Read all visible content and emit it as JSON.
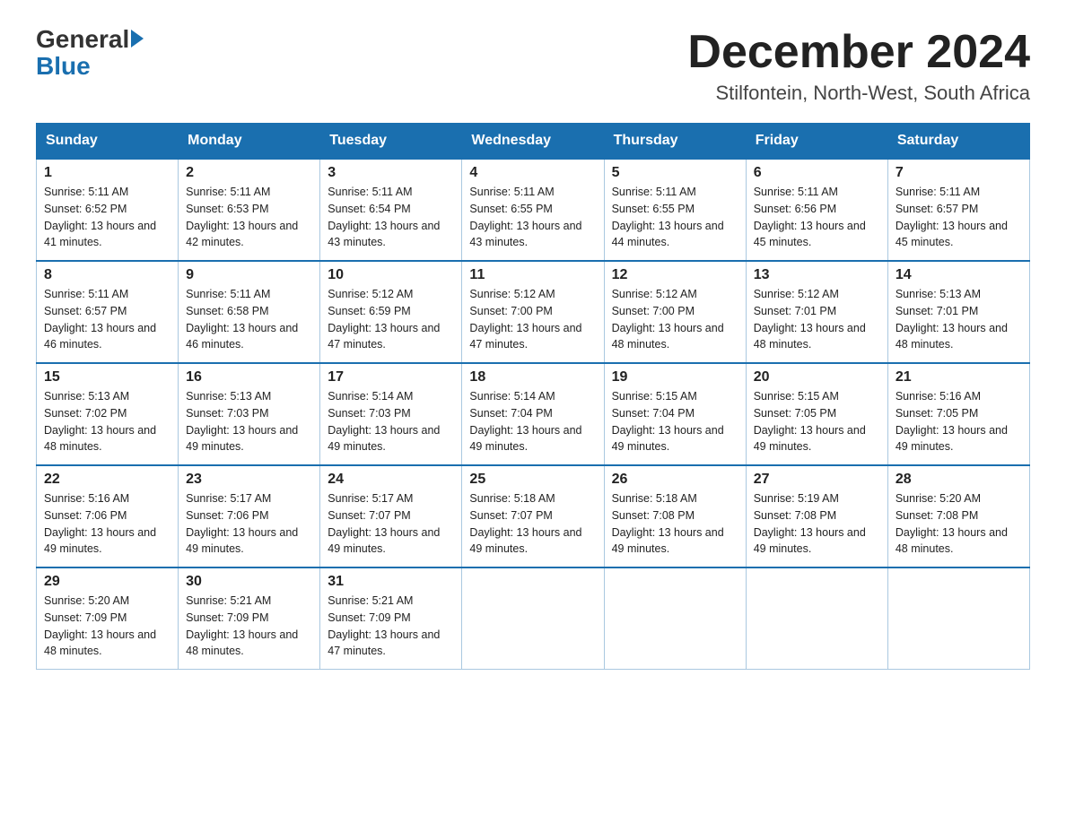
{
  "header": {
    "logo_general": "General",
    "logo_blue": "Blue",
    "month_title": "December 2024",
    "location": "Stilfontein, North-West, South Africa"
  },
  "weekdays": [
    "Sunday",
    "Monday",
    "Tuesday",
    "Wednesday",
    "Thursday",
    "Friday",
    "Saturday"
  ],
  "weeks": [
    [
      {
        "day": "1",
        "sunrise": "5:11 AM",
        "sunset": "6:52 PM",
        "daylight": "13 hours and 41 minutes."
      },
      {
        "day": "2",
        "sunrise": "5:11 AM",
        "sunset": "6:53 PM",
        "daylight": "13 hours and 42 minutes."
      },
      {
        "day": "3",
        "sunrise": "5:11 AM",
        "sunset": "6:54 PM",
        "daylight": "13 hours and 43 minutes."
      },
      {
        "day": "4",
        "sunrise": "5:11 AM",
        "sunset": "6:55 PM",
        "daylight": "13 hours and 43 minutes."
      },
      {
        "day": "5",
        "sunrise": "5:11 AM",
        "sunset": "6:55 PM",
        "daylight": "13 hours and 44 minutes."
      },
      {
        "day": "6",
        "sunrise": "5:11 AM",
        "sunset": "6:56 PM",
        "daylight": "13 hours and 45 minutes."
      },
      {
        "day": "7",
        "sunrise": "5:11 AM",
        "sunset": "6:57 PM",
        "daylight": "13 hours and 45 minutes."
      }
    ],
    [
      {
        "day": "8",
        "sunrise": "5:11 AM",
        "sunset": "6:57 PM",
        "daylight": "13 hours and 46 minutes."
      },
      {
        "day": "9",
        "sunrise": "5:11 AM",
        "sunset": "6:58 PM",
        "daylight": "13 hours and 46 minutes."
      },
      {
        "day": "10",
        "sunrise": "5:12 AM",
        "sunset": "6:59 PM",
        "daylight": "13 hours and 47 minutes."
      },
      {
        "day": "11",
        "sunrise": "5:12 AM",
        "sunset": "7:00 PM",
        "daylight": "13 hours and 47 minutes."
      },
      {
        "day": "12",
        "sunrise": "5:12 AM",
        "sunset": "7:00 PM",
        "daylight": "13 hours and 48 minutes."
      },
      {
        "day": "13",
        "sunrise": "5:12 AM",
        "sunset": "7:01 PM",
        "daylight": "13 hours and 48 minutes."
      },
      {
        "day": "14",
        "sunrise": "5:13 AM",
        "sunset": "7:01 PM",
        "daylight": "13 hours and 48 minutes."
      }
    ],
    [
      {
        "day": "15",
        "sunrise": "5:13 AM",
        "sunset": "7:02 PM",
        "daylight": "13 hours and 48 minutes."
      },
      {
        "day": "16",
        "sunrise": "5:13 AM",
        "sunset": "7:03 PM",
        "daylight": "13 hours and 49 minutes."
      },
      {
        "day": "17",
        "sunrise": "5:14 AM",
        "sunset": "7:03 PM",
        "daylight": "13 hours and 49 minutes."
      },
      {
        "day": "18",
        "sunrise": "5:14 AM",
        "sunset": "7:04 PM",
        "daylight": "13 hours and 49 minutes."
      },
      {
        "day": "19",
        "sunrise": "5:15 AM",
        "sunset": "7:04 PM",
        "daylight": "13 hours and 49 minutes."
      },
      {
        "day": "20",
        "sunrise": "5:15 AM",
        "sunset": "7:05 PM",
        "daylight": "13 hours and 49 minutes."
      },
      {
        "day": "21",
        "sunrise": "5:16 AM",
        "sunset": "7:05 PM",
        "daylight": "13 hours and 49 minutes."
      }
    ],
    [
      {
        "day": "22",
        "sunrise": "5:16 AM",
        "sunset": "7:06 PM",
        "daylight": "13 hours and 49 minutes."
      },
      {
        "day": "23",
        "sunrise": "5:17 AM",
        "sunset": "7:06 PM",
        "daylight": "13 hours and 49 minutes."
      },
      {
        "day": "24",
        "sunrise": "5:17 AM",
        "sunset": "7:07 PM",
        "daylight": "13 hours and 49 minutes."
      },
      {
        "day": "25",
        "sunrise": "5:18 AM",
        "sunset": "7:07 PM",
        "daylight": "13 hours and 49 minutes."
      },
      {
        "day": "26",
        "sunrise": "5:18 AM",
        "sunset": "7:08 PM",
        "daylight": "13 hours and 49 minutes."
      },
      {
        "day": "27",
        "sunrise": "5:19 AM",
        "sunset": "7:08 PM",
        "daylight": "13 hours and 49 minutes."
      },
      {
        "day": "28",
        "sunrise": "5:20 AM",
        "sunset": "7:08 PM",
        "daylight": "13 hours and 48 minutes."
      }
    ],
    [
      {
        "day": "29",
        "sunrise": "5:20 AM",
        "sunset": "7:09 PM",
        "daylight": "13 hours and 48 minutes."
      },
      {
        "day": "30",
        "sunrise": "5:21 AM",
        "sunset": "7:09 PM",
        "daylight": "13 hours and 48 minutes."
      },
      {
        "day": "31",
        "sunrise": "5:21 AM",
        "sunset": "7:09 PM",
        "daylight": "13 hours and 47 minutes."
      },
      null,
      null,
      null,
      null
    ]
  ]
}
